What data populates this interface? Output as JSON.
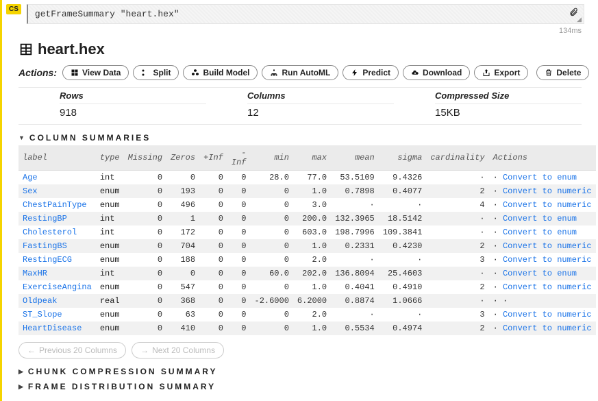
{
  "cell": {
    "badge": "CS",
    "code": "getFrameSummary \"heart.hex\""
  },
  "timing": "134ms",
  "frame": {
    "title": "heart.hex",
    "actions_label": "Actions:",
    "buttons": {
      "view_data": "View Data",
      "split": "Split",
      "build_model": "Build Model",
      "run_automl": "Run AutoML",
      "predict": "Predict",
      "download": "Download",
      "export": "Export",
      "delete": "Delete"
    },
    "meta": {
      "rows_label": "Rows",
      "rows": "918",
      "cols_label": "Columns",
      "cols": "12",
      "size_label": "Compressed Size",
      "size": "15KB"
    }
  },
  "sections": {
    "column_summaries": "COLUMN SUMMARIES",
    "chunk_compression": "CHUNK COMPRESSION SUMMARY",
    "frame_distribution": "FRAME DISTRIBUTION SUMMARY"
  },
  "table": {
    "headers": {
      "label": "label",
      "type": "type",
      "missing": "Missing",
      "zeros": "Zeros",
      "pinf": "+Inf",
      "ninf": "-Inf",
      "min": "min",
      "max": "max",
      "mean": "mean",
      "sigma": "sigma",
      "cardinality": "cardinality",
      "actions": "Actions"
    },
    "rows": [
      {
        "label": "Age",
        "type": "int",
        "missing": "0",
        "zeros": "0",
        "pinf": "0",
        "ninf": "0",
        "min": "28.0",
        "max": "77.0",
        "mean": "53.5109",
        "sigma": "9.4326",
        "cardinality": "·",
        "action": "Convert to enum"
      },
      {
        "label": "Sex",
        "type": "enum",
        "missing": "0",
        "zeros": "193",
        "pinf": "0",
        "ninf": "0",
        "min": "0",
        "max": "1.0",
        "mean": "0.7898",
        "sigma": "0.4077",
        "cardinality": "2",
        "action": "Convert to numeric"
      },
      {
        "label": "ChestPainType",
        "type": "enum",
        "missing": "0",
        "zeros": "496",
        "pinf": "0",
        "ninf": "0",
        "min": "0",
        "max": "3.0",
        "mean": "·",
        "sigma": "·",
        "cardinality": "4",
        "action": "Convert to numeric"
      },
      {
        "label": "RestingBP",
        "type": "int",
        "missing": "0",
        "zeros": "1",
        "pinf": "0",
        "ninf": "0",
        "min": "0",
        "max": "200.0",
        "mean": "132.3965",
        "sigma": "18.5142",
        "cardinality": "·",
        "action": "Convert to enum"
      },
      {
        "label": "Cholesterol",
        "type": "int",
        "missing": "0",
        "zeros": "172",
        "pinf": "0",
        "ninf": "0",
        "min": "0",
        "max": "603.0",
        "mean": "198.7996",
        "sigma": "109.3841",
        "cardinality": "·",
        "action": "Convert to enum"
      },
      {
        "label": "FastingBS",
        "type": "enum",
        "missing": "0",
        "zeros": "704",
        "pinf": "0",
        "ninf": "0",
        "min": "0",
        "max": "1.0",
        "mean": "0.2331",
        "sigma": "0.4230",
        "cardinality": "2",
        "action": "Convert to numeric"
      },
      {
        "label": "RestingECG",
        "type": "enum",
        "missing": "0",
        "zeros": "188",
        "pinf": "0",
        "ninf": "0",
        "min": "0",
        "max": "2.0",
        "mean": "·",
        "sigma": "·",
        "cardinality": "3",
        "action": "Convert to numeric"
      },
      {
        "label": "MaxHR",
        "type": "int",
        "missing": "0",
        "zeros": "0",
        "pinf": "0",
        "ninf": "0",
        "min": "60.0",
        "max": "202.0",
        "mean": "136.8094",
        "sigma": "25.4603",
        "cardinality": "·",
        "action": "Convert to enum"
      },
      {
        "label": "ExerciseAngina",
        "type": "enum",
        "missing": "0",
        "zeros": "547",
        "pinf": "0",
        "ninf": "0",
        "min": "0",
        "max": "1.0",
        "mean": "0.4041",
        "sigma": "0.4910",
        "cardinality": "2",
        "action": "Convert to numeric"
      },
      {
        "label": "Oldpeak",
        "type": "real",
        "missing": "0",
        "zeros": "368",
        "pinf": "0",
        "ninf": "0",
        "min": "-2.6000",
        "max": "6.2000",
        "mean": "0.8874",
        "sigma": "1.0666",
        "cardinality": "·",
        "action": "·"
      },
      {
        "label": "ST_Slope",
        "type": "enum",
        "missing": "0",
        "zeros": "63",
        "pinf": "0",
        "ninf": "0",
        "min": "0",
        "max": "2.0",
        "mean": "·",
        "sigma": "·",
        "cardinality": "3",
        "action": "Convert to numeric"
      },
      {
        "label": "HeartDisease",
        "type": "enum",
        "missing": "0",
        "zeros": "410",
        "pinf": "0",
        "ninf": "0",
        "min": "0",
        "max": "1.0",
        "mean": "0.5534",
        "sigma": "0.4974",
        "cardinality": "2",
        "action": "Convert to numeric"
      }
    ]
  },
  "pager": {
    "prev": "Previous 20 Columns",
    "next": "Next 20 Columns"
  }
}
